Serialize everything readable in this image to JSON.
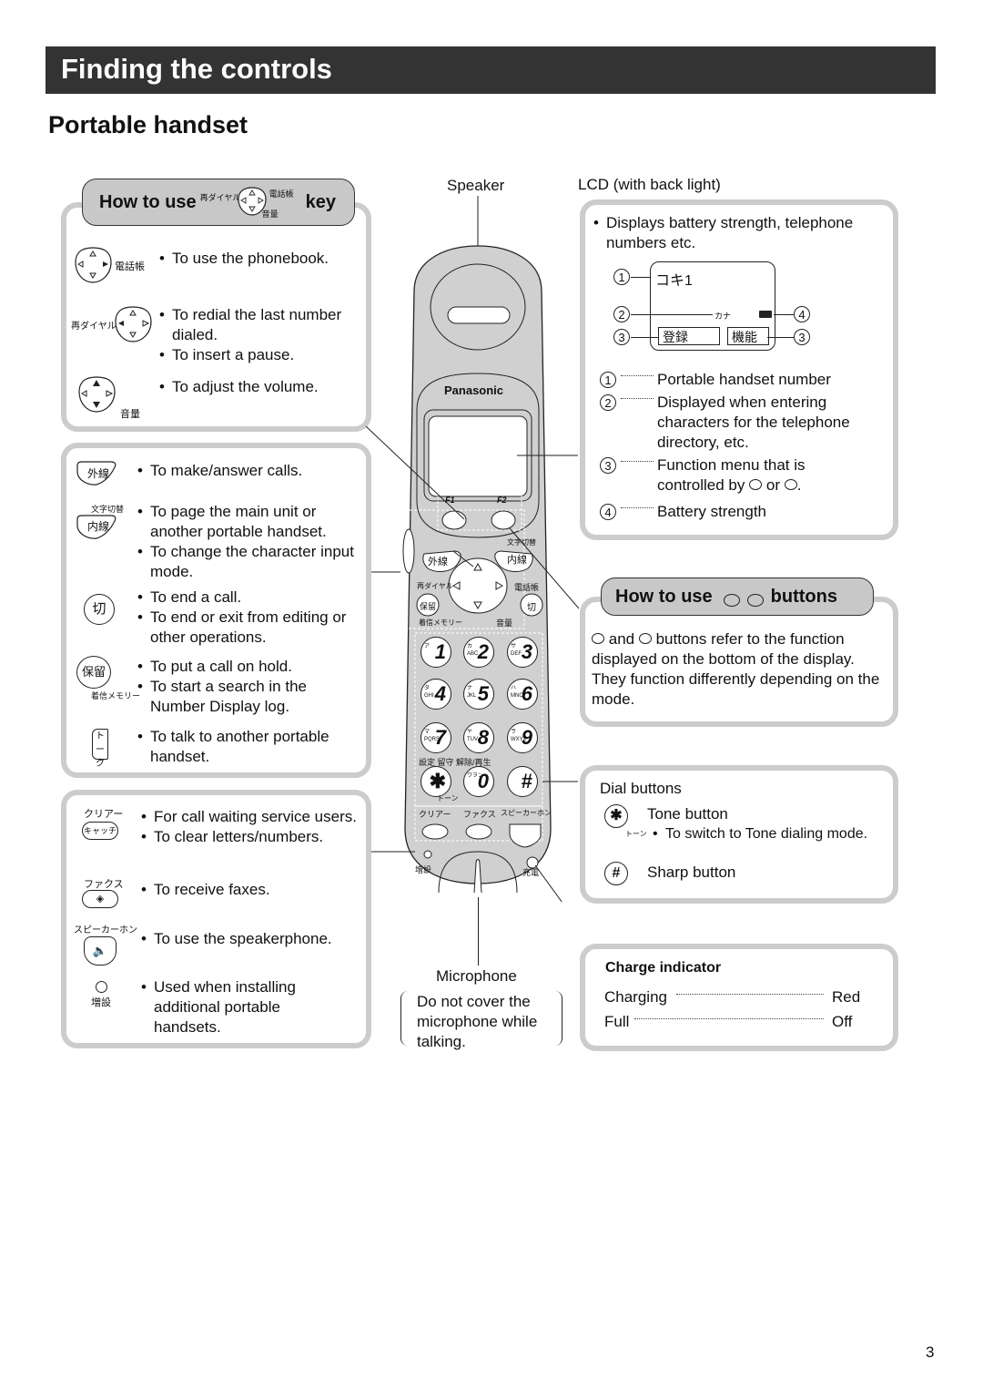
{
  "header": {
    "title": "Finding the controls",
    "subtitle": "Portable handset"
  },
  "page_number": "3",
  "nav_key_panel": {
    "title_prefix": "How to use",
    "title_suffix": "key",
    "key_labels": {
      "left": "再ダイヤル",
      "right": "電話帳",
      "down": "音量"
    },
    "items": [
      {
        "icon": "nav-key-right-icon",
        "icon_label": "電話帳",
        "bullets": [
          "To use the phonebook."
        ]
      },
      {
        "icon": "nav-key-left-icon",
        "icon_label": "再ダイヤル",
        "bullets": [
          "To redial the last number dialed.",
          "To insert a pause."
        ]
      },
      {
        "icon": "nav-key-updown-icon",
        "icon_label": "音量",
        "bullets": [
          "To adjust the volume."
        ]
      }
    ]
  },
  "buttons_panel": {
    "items": [
      {
        "icon": "outside-line-key-icon",
        "key_text": "外線",
        "sub_label": "",
        "bullets": [
          "To make/answer calls."
        ]
      },
      {
        "icon": "intercom-key-icon",
        "key_text": "内線",
        "sub_label": "文字切替",
        "bullets": [
          "To page the main unit or another portable handset.",
          "To change the character input mode."
        ]
      },
      {
        "icon": "off-key-icon",
        "key_text": "切",
        "sub_label": "",
        "bullets": [
          "To end a call.",
          "To end or exit from editing or other operations."
        ]
      },
      {
        "icon": "hold-key-icon",
        "key_text": "保留",
        "sub_label": "着信メモリー",
        "bullets": [
          "To put a call on hold.",
          "To start a search in the Number Display log."
        ]
      },
      {
        "icon": "talk-key-icon",
        "key_text": "トーク",
        "sub_label": "",
        "bullets": [
          "To talk to another portable handset."
        ]
      }
    ]
  },
  "extra_panel": {
    "items": [
      {
        "icon": "catch-key-icon",
        "key_text": "キャッチ",
        "top_label": "クリアー",
        "bullets": [
          "For call waiting service users.",
          "To clear letters/numbers."
        ]
      },
      {
        "icon": "fax-key-icon",
        "key_text": "◈",
        "top_label": "ファクス",
        "bullets": [
          "To receive faxes."
        ]
      },
      {
        "icon": "speakerphone-key-icon",
        "key_text": "🔈",
        "top_label": "スピーカーホン",
        "bullets": [
          "To use the speakerphone."
        ]
      },
      {
        "icon": "install-button-icon",
        "key_text": "○",
        "top_label": "増設",
        "bullets": [
          "Used when installing additional portable handsets."
        ]
      }
    ]
  },
  "handset": {
    "speaker_label": "Speaker",
    "brand": "Panasonic",
    "f1": "F1",
    "f2": "F2",
    "moji": "文字切替",
    "gaisen": "外線",
    "naisen": "内線",
    "redial": "再ダイヤル",
    "phonebook": "電話帳",
    "hold": "保留",
    "off": "切",
    "memory": "着信メモリー",
    "volume": "音量",
    "keys": [
      {
        "main": "1",
        "kana": "ア",
        "alpha": ""
      },
      {
        "main": "2",
        "kana": "カ",
        "alpha": "ABC"
      },
      {
        "main": "3",
        "kana": "サ",
        "alpha": "DEF"
      },
      {
        "main": "4",
        "kana": "タ",
        "alpha": "GHI"
      },
      {
        "main": "5",
        "kana": "ナ",
        "alpha": "JKL"
      },
      {
        "main": "6",
        "kana": "ハ",
        "alpha": "MNO"
      },
      {
        "main": "7",
        "kana": "マ",
        "alpha": "PQRS"
      },
      {
        "main": "8",
        "kana": "ヤ",
        "alpha": "TUV"
      },
      {
        "main": "9",
        "kana": "ラ",
        "alpha": "WXYZ"
      },
      {
        "main": "✱",
        "kana": "",
        "alpha": ""
      },
      {
        "main": "0",
        "kana": "ワヲン",
        "alpha": ""
      },
      {
        "main": "#",
        "kana": "",
        "alpha": ""
      }
    ],
    "answering_row": "設定 留守 解除/再生",
    "tone": "トーン",
    "func_labels": [
      "クリアー",
      "ファクス",
      "スピーカーホン"
    ],
    "catch": "キャッチ",
    "zousetsu": "増設",
    "charge": "充電",
    "microphone_label": "Microphone",
    "microphone_note": "Do not cover the microphone while talking."
  },
  "lcd_panel": {
    "header_label": "LCD (with back light)",
    "bullet": "Displays battery strength, telephone numbers etc.",
    "screen": {
      "line1": "コキ1",
      "kana_indicator": "カナ",
      "soft_left": "登録",
      "soft_right": "機能"
    },
    "callouts": [
      "1",
      "2",
      "3",
      "4",
      "3"
    ],
    "legend": [
      {
        "num": "1",
        "text": "Portable handset number"
      },
      {
        "num": "2",
        "text": "Displayed when entering characters for the telephone directory, etc."
      },
      {
        "num": "3",
        "text_before": "Function menu that is controlled by",
        "text_mid": "or",
        "text_after": "."
      },
      {
        "num": "4",
        "text": "Battery strength"
      }
    ]
  },
  "fbuttons_panel": {
    "title_prefix": "How to use",
    "title_suffix": "buttons",
    "f1": "F1",
    "f2": "F2",
    "text_and": "and",
    "text_body": "buttons refer to the function displayed on the bottom of the display. They function differently depending on the mode."
  },
  "dial_panel": {
    "title": "Dial buttons",
    "tone_label": "Tone button",
    "tone_sub": "トーン",
    "tone_bullet": "To switch to Tone dialing mode.",
    "sharp_label": "Sharp button"
  },
  "charge_panel": {
    "title": "Charge indicator",
    "rows": [
      {
        "state": "Charging",
        "value": "Red"
      },
      {
        "state": "Full",
        "value": "Off"
      }
    ]
  }
}
